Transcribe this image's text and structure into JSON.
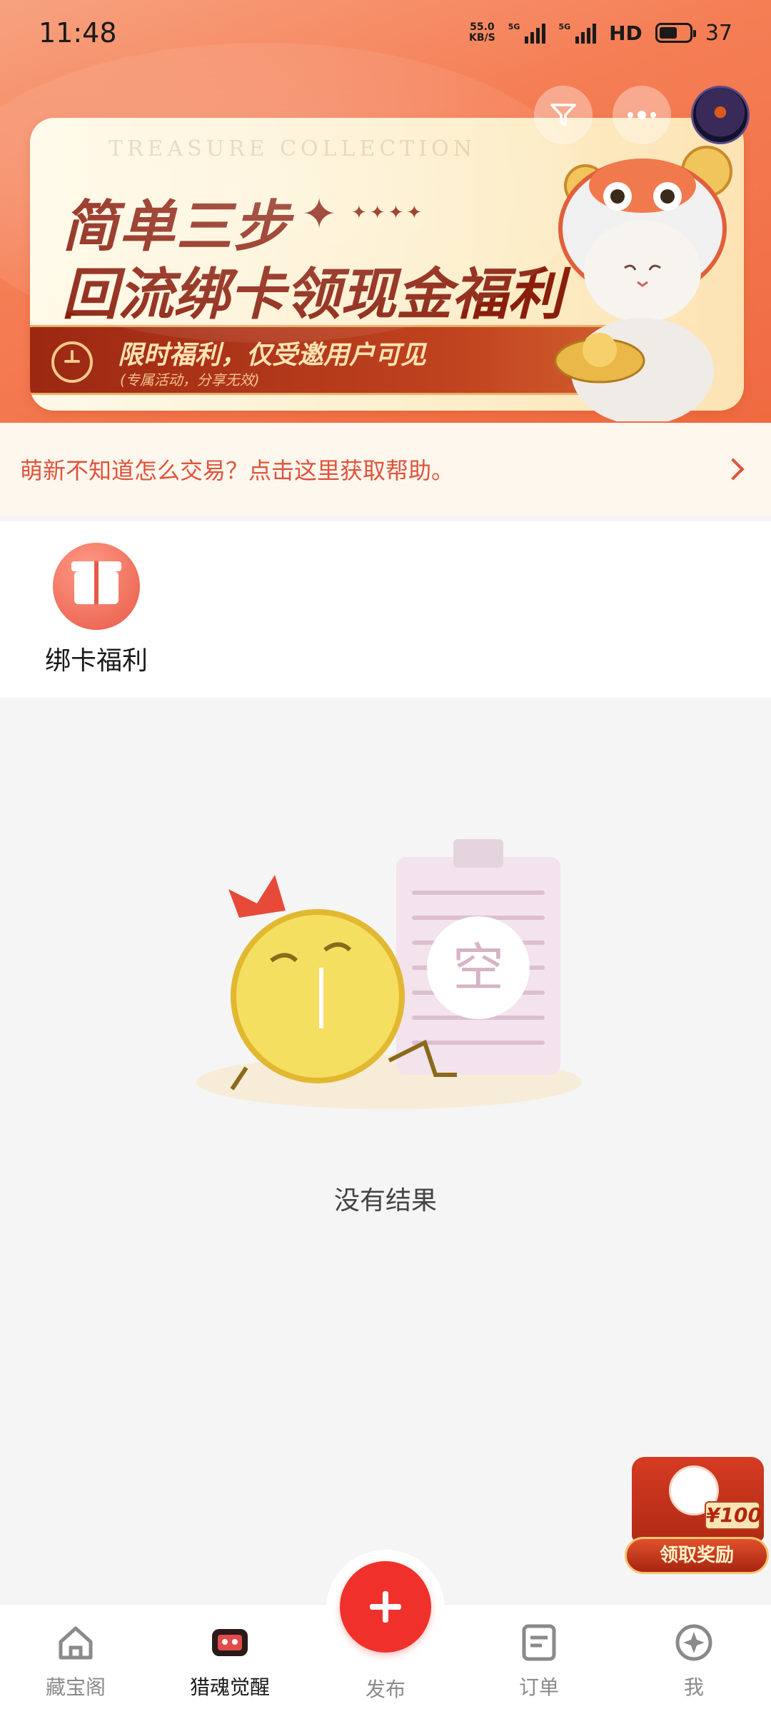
{
  "status_bar": {
    "time": "11:48",
    "net_speed_value": "55.0",
    "net_speed_unit": "KB/S",
    "sim1": "5G",
    "sim2": "5G",
    "hd": "HD",
    "battery": "37"
  },
  "header": {
    "filter_icon": "filter-icon",
    "more_icon": "more-icon"
  },
  "banner": {
    "watermark": "TREASURE COLLECTION",
    "title_line1": "简单三步",
    "title_line2": "回流绑卡领现金福利",
    "ribbon_main": "限时福利，仅受邀用户可见",
    "ribbon_sub": "(专属活动，分享无效)"
  },
  "help": {
    "text": "萌新不知道怎么交易？点击这里获取帮助。"
  },
  "quick_entries": [
    {
      "label": "绑卡福利",
      "icon": "gift-icon"
    }
  ],
  "empty_state": {
    "badge": "空",
    "text": "没有结果"
  },
  "reward_badge": {
    "amount": "¥100",
    "button": "领取奖励"
  },
  "tabs": [
    {
      "label": "藏宝阁",
      "icon": "home-icon"
    },
    {
      "label": "猎魂觉醒",
      "icon": "game-icon",
      "active": true
    },
    {
      "label": "发布",
      "icon": "plus-icon"
    },
    {
      "label": "订单",
      "icon": "order-icon"
    },
    {
      "label": "我",
      "icon": "profile-icon"
    }
  ],
  "colors": {
    "accent": "#f0312b",
    "help_text": "#e0533b",
    "banner_title": "#8a1e0c"
  }
}
